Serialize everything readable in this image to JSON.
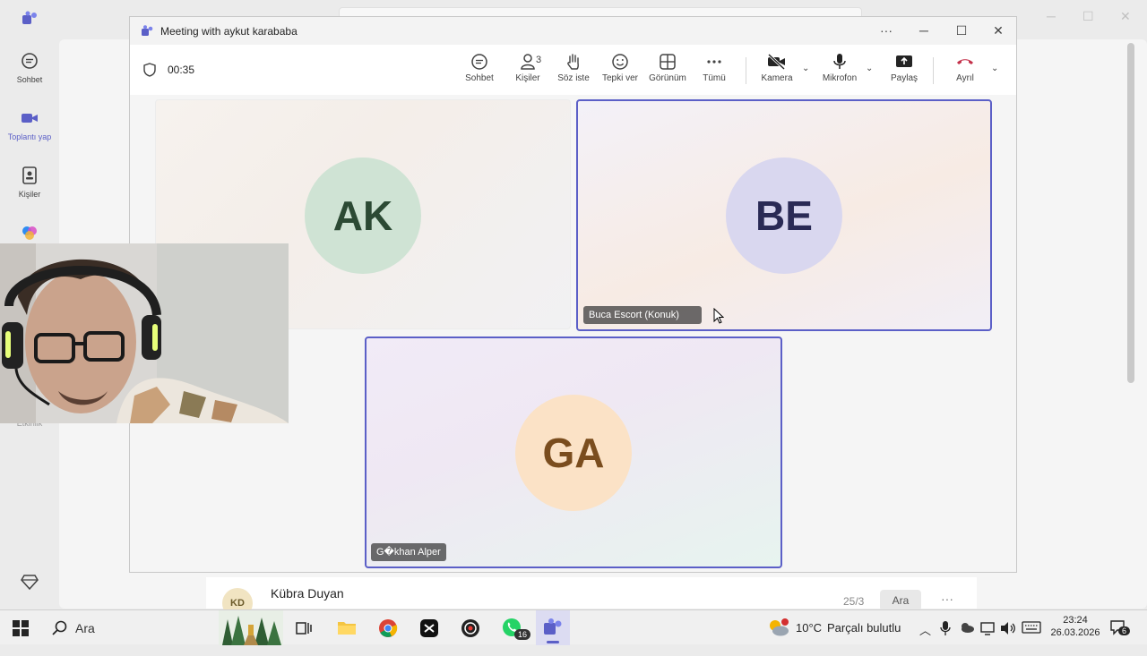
{
  "rail": {
    "items": [
      {
        "label": "Sohbet",
        "icon": "chat-icon"
      },
      {
        "label": "Toplantı yap",
        "icon": "video-camera-icon"
      },
      {
        "label": "Kişiler",
        "icon": "contacts-icon"
      },
      {
        "label": "",
        "icon": "copilot-icon"
      }
    ],
    "hidden_label": "Etkinlik"
  },
  "meeting": {
    "title": "Meeting with aykut karababa",
    "timer": "00:35",
    "toolbar": {
      "chat": "Sohbet",
      "people": "Kişiler",
      "people_count": "3",
      "raise_hand": "Söz iste",
      "react": "Tepki ver",
      "view": "Görünüm",
      "more": "Tümü",
      "camera": "Kamera",
      "mic": "Mikrofon",
      "share": "Paylaş",
      "leave": "Ayrıl"
    },
    "participants": [
      {
        "initials": "AK",
        "name": ""
      },
      {
        "initials": "BE",
        "name": "Buca Escort (Konuk)"
      },
      {
        "initials": "GA",
        "name": "G�khan Alper"
      }
    ],
    "colors": {
      "accent": "#5b5fc7",
      "leave": "#c4314b"
    }
  },
  "background": {
    "chat_row_avatar": "KD",
    "chat_row_name": "Kübra Duyan",
    "chat_row_date": "25/3",
    "chat_row_button": "Ara"
  },
  "taskbar": {
    "search": "Ara",
    "whatsapp_badge": "16",
    "weather_temp": "10°C",
    "weather_desc": "Parçalı bulutlu",
    "time": "23:24",
    "date": "26.03.2026",
    "notification_count": "6"
  }
}
